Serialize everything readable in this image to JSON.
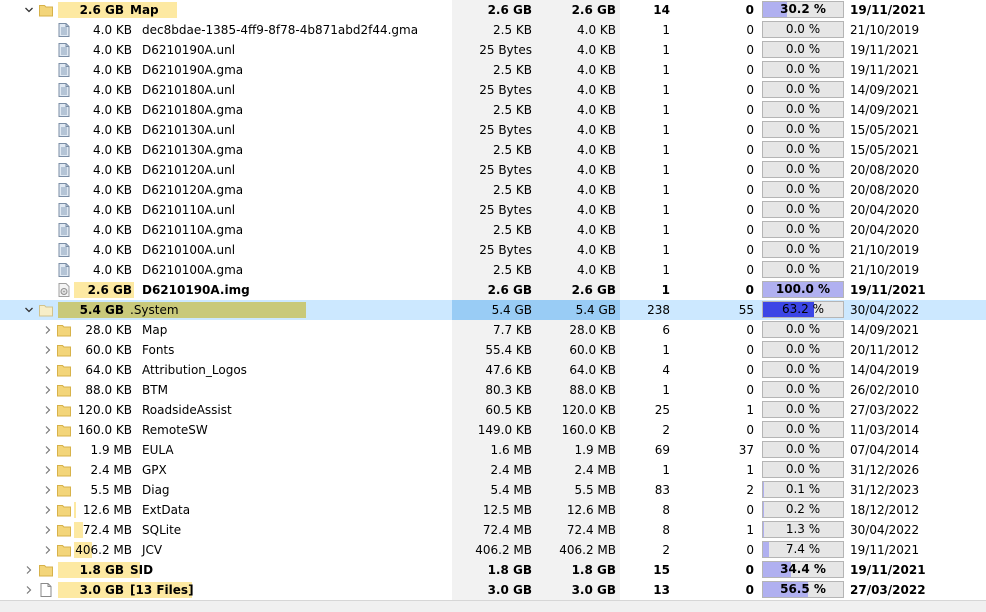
{
  "colors": {
    "size_bar": "#fde9a2",
    "system_bar": "#c9c97a",
    "selected_row": "#cce8ff",
    "pct_fill": "#b0b0f0",
    "pct_fill_selected": "#3c46e6"
  },
  "rows": [
    {
      "level": 0,
      "expand": "down",
      "icon": "folder",
      "size_label": "2.6 GB",
      "name": "Map",
      "size": "2.6 GB",
      "allocated": "2.6 GB",
      "files": "14",
      "folders": "0",
      "percent_label": "30.2 %",
      "percent": 30.2,
      "bar_fraction": 0.48,
      "modified": "19/11/2021",
      "bold": true,
      "selected": false
    },
    {
      "level": 1,
      "expand": "",
      "icon": "file",
      "size_label": "4.0 KB",
      "name": "dec8bdae-1385-4ff9-8f78-4b871abd2f44.gma",
      "size": "2.5 KB",
      "allocated": "4.0 KB",
      "files": "1",
      "folders": "0",
      "percent_label": "0.0 %",
      "percent": 0,
      "bar_fraction": 0,
      "modified": "21/10/2019",
      "bold": false,
      "selected": false
    },
    {
      "level": 1,
      "expand": "",
      "icon": "file",
      "size_label": "4.0 KB",
      "name": "D6210190A.unl",
      "size": "25 Bytes",
      "allocated": "4.0 KB",
      "files": "1",
      "folders": "0",
      "percent_label": "0.0 %",
      "percent": 0,
      "bar_fraction": 0,
      "modified": "19/11/2021",
      "bold": false,
      "selected": false
    },
    {
      "level": 1,
      "expand": "",
      "icon": "file",
      "size_label": "4.0 KB",
      "name": "D6210190A.gma",
      "size": "2.5 KB",
      "allocated": "4.0 KB",
      "files": "1",
      "folders": "0",
      "percent_label": "0.0 %",
      "percent": 0,
      "bar_fraction": 0,
      "modified": "19/11/2021",
      "bold": false,
      "selected": false
    },
    {
      "level": 1,
      "expand": "",
      "icon": "file",
      "size_label": "4.0 KB",
      "name": "D6210180A.unl",
      "size": "25 Bytes",
      "allocated": "4.0 KB",
      "files": "1",
      "folders": "0",
      "percent_label": "0.0 %",
      "percent": 0,
      "bar_fraction": 0,
      "modified": "14/09/2021",
      "bold": false,
      "selected": false
    },
    {
      "level": 1,
      "expand": "",
      "icon": "file",
      "size_label": "4.0 KB",
      "name": "D6210180A.gma",
      "size": "2.5 KB",
      "allocated": "4.0 KB",
      "files": "1",
      "folders": "0",
      "percent_label": "0.0 %",
      "percent": 0,
      "bar_fraction": 0,
      "modified": "14/09/2021",
      "bold": false,
      "selected": false
    },
    {
      "level": 1,
      "expand": "",
      "icon": "file",
      "size_label": "4.0 KB",
      "name": "D6210130A.unl",
      "size": "25 Bytes",
      "allocated": "4.0 KB",
      "files": "1",
      "folders": "0",
      "percent_label": "0.0 %",
      "percent": 0,
      "bar_fraction": 0,
      "modified": "15/05/2021",
      "bold": false,
      "selected": false
    },
    {
      "level": 1,
      "expand": "",
      "icon": "file",
      "size_label": "4.0 KB",
      "name": "D6210130A.gma",
      "size": "2.5 KB",
      "allocated": "4.0 KB",
      "files": "1",
      "folders": "0",
      "percent_label": "0.0 %",
      "percent": 0,
      "bar_fraction": 0,
      "modified": "15/05/2021",
      "bold": false,
      "selected": false
    },
    {
      "level": 1,
      "expand": "",
      "icon": "file",
      "size_label": "4.0 KB",
      "name": "D6210120A.unl",
      "size": "25 Bytes",
      "allocated": "4.0 KB",
      "files": "1",
      "folders": "0",
      "percent_label": "0.0 %",
      "percent": 0,
      "bar_fraction": 0,
      "modified": "20/08/2020",
      "bold": false,
      "selected": false
    },
    {
      "level": 1,
      "expand": "",
      "icon": "file",
      "size_label": "4.0 KB",
      "name": "D6210120A.gma",
      "size": "2.5 KB",
      "allocated": "4.0 KB",
      "files": "1",
      "folders": "0",
      "percent_label": "0.0 %",
      "percent": 0,
      "bar_fraction": 0,
      "modified": "20/08/2020",
      "bold": false,
      "selected": false
    },
    {
      "level": 1,
      "expand": "",
      "icon": "file",
      "size_label": "4.0 KB",
      "name": "D6210110A.unl",
      "size": "25 Bytes",
      "allocated": "4.0 KB",
      "files": "1",
      "folders": "0",
      "percent_label": "0.0 %",
      "percent": 0,
      "bar_fraction": 0,
      "modified": "20/04/2020",
      "bold": false,
      "selected": false
    },
    {
      "level": 1,
      "expand": "",
      "icon": "file",
      "size_label": "4.0 KB",
      "name": "D6210110A.gma",
      "size": "2.5 KB",
      "allocated": "4.0 KB",
      "files": "1",
      "folders": "0",
      "percent_label": "0.0 %",
      "percent": 0,
      "bar_fraction": 0,
      "modified": "20/04/2020",
      "bold": false,
      "selected": false
    },
    {
      "level": 1,
      "expand": "",
      "icon": "file",
      "size_label": "4.0 KB",
      "name": "D6210100A.unl",
      "size": "25 Bytes",
      "allocated": "4.0 KB",
      "files": "1",
      "folders": "0",
      "percent_label": "0.0 %",
      "percent": 0,
      "bar_fraction": 0,
      "modified": "21/10/2019",
      "bold": false,
      "selected": false
    },
    {
      "level": 1,
      "expand": "",
      "icon": "file",
      "size_label": "4.0 KB",
      "name": "D6210100A.gma",
      "size": "2.5 KB",
      "allocated": "4.0 KB",
      "files": "1",
      "folders": "0",
      "percent_label": "0.0 %",
      "percent": 0,
      "bar_fraction": 0,
      "modified": "21/10/2019",
      "bold": false,
      "selected": false
    },
    {
      "level": 1,
      "expand": "",
      "icon": "disk",
      "size_label": "2.6 GB",
      "name": "D6210190A.img",
      "size": "2.6 GB",
      "allocated": "2.6 GB",
      "files": "1",
      "folders": "0",
      "percent_label": "100.0 %",
      "percent": 100,
      "bar_fraction": 0.26,
      "modified": "19/11/2021",
      "bold": true,
      "selected": false
    },
    {
      "level": 0,
      "expand": "down",
      "icon": "folder-light",
      "size_label": "5.4 GB",
      "name": ".System",
      "size": "5.4 GB",
      "allocated": "5.4 GB",
      "files": "238",
      "folders": "55",
      "percent_label": "63.2 %",
      "percent": 63.2,
      "bar_fraction": 1.0,
      "modified": "30/04/2022",
      "bold": false,
      "selected": true
    },
    {
      "level": 1,
      "expand": "right",
      "icon": "folder",
      "size_label": "28.0 KB",
      "name": "Map",
      "size": "7.7 KB",
      "allocated": "28.0 KB",
      "files": "6",
      "folders": "0",
      "percent_label": "0.0 %",
      "percent": 0,
      "bar_fraction": 0,
      "modified": "14/09/2021",
      "bold": false,
      "selected": false
    },
    {
      "level": 1,
      "expand": "right",
      "icon": "folder",
      "size_label": "60.0 KB",
      "name": "Fonts",
      "size": "55.4 KB",
      "allocated": "60.0 KB",
      "files": "1",
      "folders": "0",
      "percent_label": "0.0 %",
      "percent": 0,
      "bar_fraction": 0,
      "modified": "20/11/2012",
      "bold": false,
      "selected": false
    },
    {
      "level": 1,
      "expand": "right",
      "icon": "folder",
      "size_label": "64.0 KB",
      "name": "Attribution_Logos",
      "size": "47.6 KB",
      "allocated": "64.0 KB",
      "files": "4",
      "folders": "0",
      "percent_label": "0.0 %",
      "percent": 0,
      "bar_fraction": 0,
      "modified": "14/04/2019",
      "bold": false,
      "selected": false
    },
    {
      "level": 1,
      "expand": "right",
      "icon": "folder",
      "size_label": "88.0 KB",
      "name": "BTM",
      "size": "80.3 KB",
      "allocated": "88.0 KB",
      "files": "1",
      "folders": "0",
      "percent_label": "0.0 %",
      "percent": 0,
      "bar_fraction": 0,
      "modified": "26/02/2010",
      "bold": false,
      "selected": false
    },
    {
      "level": 1,
      "expand": "right",
      "icon": "folder",
      "size_label": "120.0 KB",
      "name": "RoadsideAssist",
      "size": "60.5 KB",
      "allocated": "120.0 KB",
      "files": "25",
      "folders": "1",
      "percent_label": "0.0 %",
      "percent": 0,
      "bar_fraction": 0,
      "modified": "27/03/2022",
      "bold": false,
      "selected": false
    },
    {
      "level": 1,
      "expand": "right",
      "icon": "folder",
      "size_label": "160.0 KB",
      "name": "RemoteSW",
      "size": "149.0 KB",
      "allocated": "160.0 KB",
      "files": "2",
      "folders": "0",
      "percent_label": "0.0 %",
      "percent": 0,
      "bar_fraction": 0,
      "modified": "11/03/2014",
      "bold": false,
      "selected": false
    },
    {
      "level": 1,
      "expand": "right",
      "icon": "folder",
      "size_label": "1.9 MB",
      "name": "EULA",
      "size": "1.6 MB",
      "allocated": "1.9 MB",
      "files": "69",
      "folders": "37",
      "percent_label": "0.0 %",
      "percent": 0,
      "bar_fraction": 0,
      "modified": "07/04/2014",
      "bold": false,
      "selected": false
    },
    {
      "level": 1,
      "expand": "right",
      "icon": "folder",
      "size_label": "2.4 MB",
      "name": "GPX",
      "size": "2.4 MB",
      "allocated": "2.4 MB",
      "files": "1",
      "folders": "1",
      "percent_label": "0.0 %",
      "percent": 0,
      "bar_fraction": 0,
      "modified": "31/12/2026",
      "bold": false,
      "selected": false
    },
    {
      "level": 1,
      "expand": "right",
      "icon": "folder",
      "size_label": "5.5 MB",
      "name": "Diag",
      "size": "5.4 MB",
      "allocated": "5.5 MB",
      "files": "83",
      "folders": "2",
      "percent_label": "0.1 %",
      "percent": 0.1,
      "bar_fraction": 0,
      "modified": "31/12/2023",
      "bold": false,
      "selected": false
    },
    {
      "level": 1,
      "expand": "right",
      "icon": "folder",
      "size_label": "12.6 MB",
      "name": "ExtData",
      "size": "12.5 MB",
      "allocated": "12.6 MB",
      "files": "8",
      "folders": "0",
      "percent_label": "0.2 %",
      "percent": 0.2,
      "bar_fraction": 0.01,
      "modified": "18/12/2012",
      "bold": false,
      "selected": false
    },
    {
      "level": 1,
      "expand": "right",
      "icon": "folder",
      "size_label": "72.4 MB",
      "name": "SQLite",
      "size": "72.4 MB",
      "allocated": "72.4 MB",
      "files": "8",
      "folders": "1",
      "percent_label": "1.3 %",
      "percent": 1.3,
      "bar_fraction": 0.04,
      "modified": "30/04/2022",
      "bold": false,
      "selected": false
    },
    {
      "level": 1,
      "expand": "right",
      "icon": "folder",
      "size_label": "406.2 MB",
      "name": "JCV",
      "size": "406.2 MB",
      "allocated": "406.2 MB",
      "files": "2",
      "folders": "0",
      "percent_label": "7.4 %",
      "percent": 7.4,
      "bar_fraction": 0.08,
      "modified": "19/11/2021",
      "bold": false,
      "selected": false
    },
    {
      "level": 0,
      "expand": "right",
      "icon": "folder",
      "size_label": "1.8 GB",
      "name": "SID",
      "size": "1.8 GB",
      "allocated": "1.8 GB",
      "files": "15",
      "folders": "0",
      "percent_label": "34.4 %",
      "percent": 34.4,
      "bar_fraction": 0.33,
      "modified": "19/11/2021",
      "bold": true,
      "selected": false
    },
    {
      "level": 0,
      "expand": "right",
      "icon": "file-blank",
      "size_label": "3.0 GB",
      "name": "[13 Files]",
      "size": "3.0 GB",
      "allocated": "3.0 GB",
      "files": "13",
      "folders": "0",
      "percent_label": "56.5 %",
      "percent": 56.5,
      "bar_fraction": 0.54,
      "modified": "27/03/2022",
      "bold": true,
      "selected": false
    }
  ]
}
